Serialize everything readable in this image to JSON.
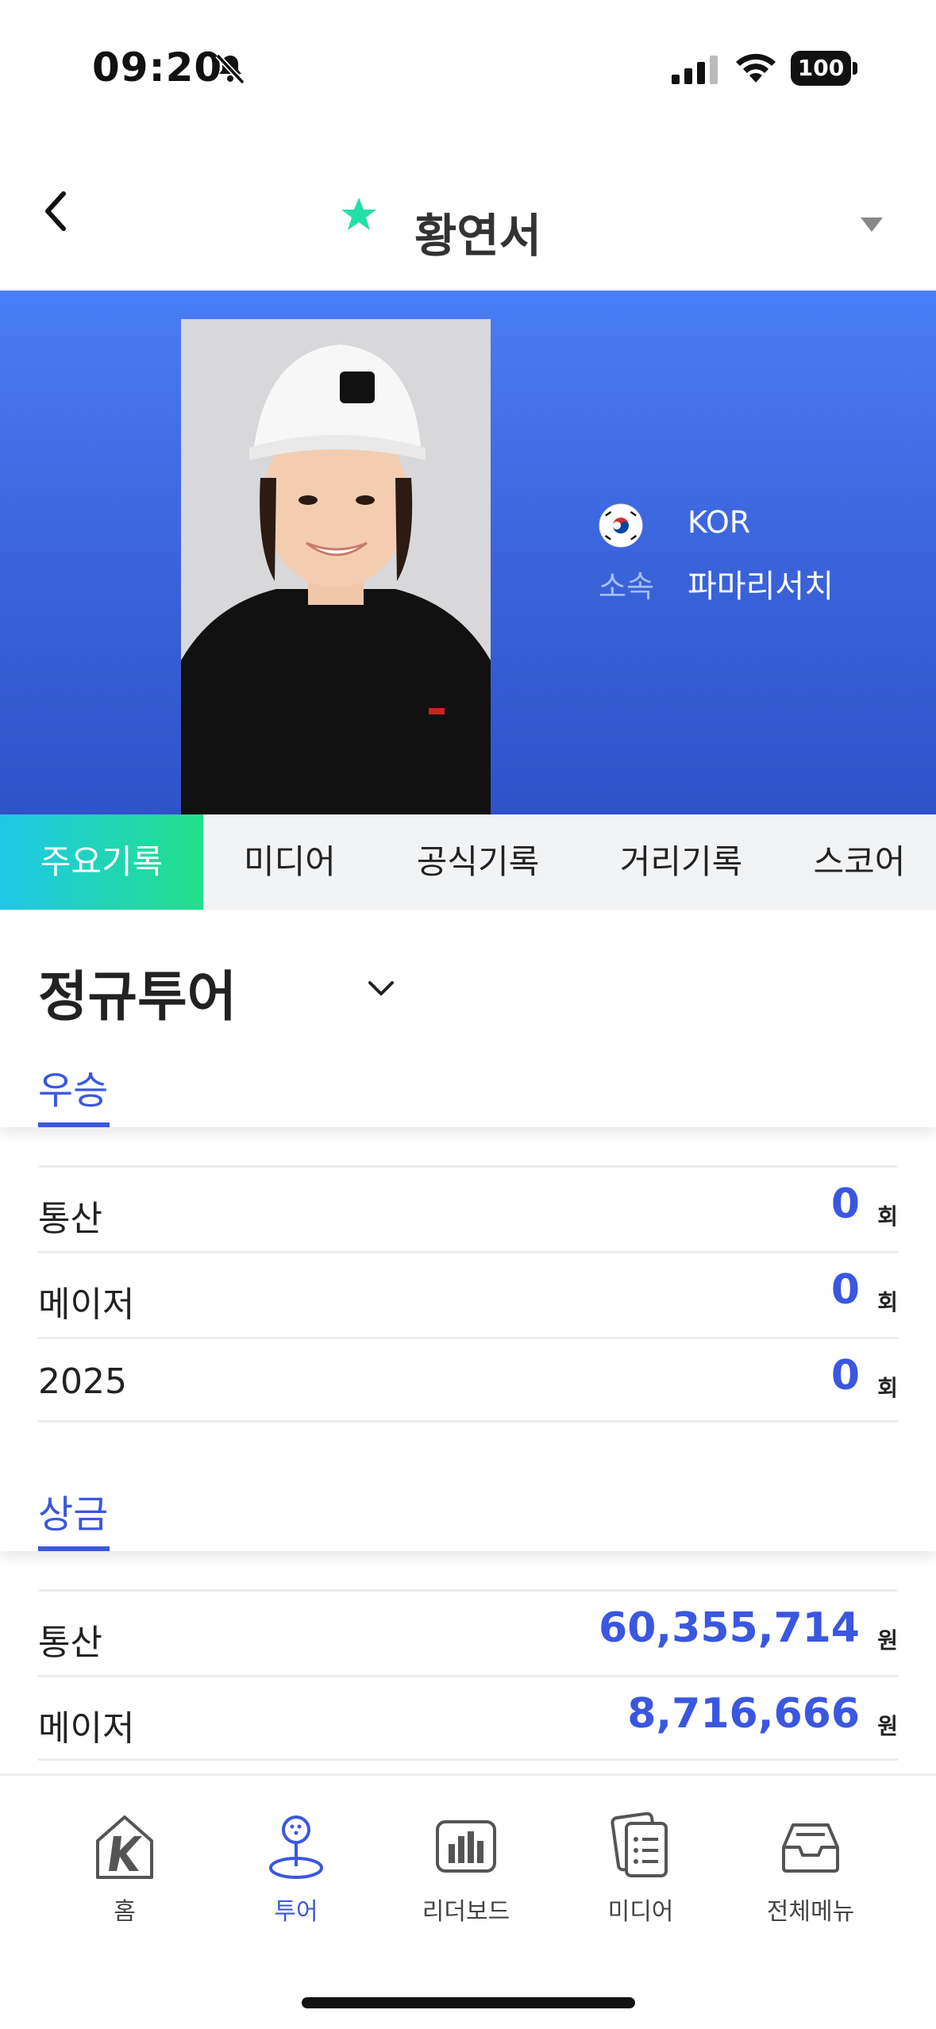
{
  "status_bar": {
    "time": "09:20",
    "battery": "100"
  },
  "header": {
    "player_name": "황연서"
  },
  "profile": {
    "country": "KOR",
    "affiliation_label": "소속",
    "affiliation": "파마리서치"
  },
  "tabs": [
    {
      "label": "주요기록"
    },
    {
      "label": "미디어"
    },
    {
      "label": "공식기록"
    },
    {
      "label": "거리기록"
    },
    {
      "label": "스코어"
    }
  ],
  "tour_select": {
    "value": "정규투어"
  },
  "wins": {
    "title": "우승",
    "rows": [
      {
        "label": "통산",
        "value": "0",
        "unit": "회"
      },
      {
        "label": "메이저",
        "value": "0",
        "unit": "회"
      },
      {
        "label": "2025",
        "value": "0",
        "unit": "회"
      }
    ]
  },
  "prize": {
    "title": "상금",
    "rows": [
      {
        "label": "통산",
        "value": "60,355,714",
        "unit": "원"
      },
      {
        "label": "메이저",
        "value": "8,716,666",
        "unit": "원"
      }
    ]
  },
  "bottom_nav": [
    {
      "label": "홈"
    },
    {
      "label": "투어"
    },
    {
      "label": "리더보드"
    },
    {
      "label": "미디어"
    },
    {
      "label": "전체메뉴"
    }
  ],
  "colors": {
    "accent": "#3a57e0",
    "hero": "#3f6ae6",
    "tab_active_start": "#1ec8e8",
    "tab_active_end": "#22e08a",
    "star": "#22e0a8"
  }
}
